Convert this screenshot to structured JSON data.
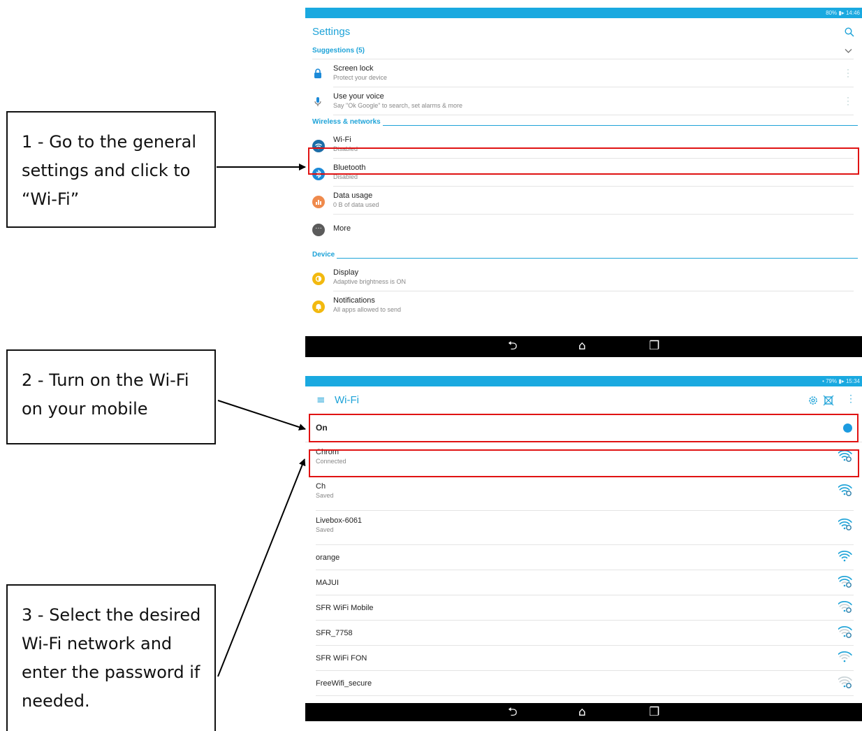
{
  "callouts": [
    {
      "text": "1 - Go to the general settings and click to “Wi-Fi”"
    },
    {
      "text": "2 - Turn on the Wi-Fi on your mobile"
    },
    {
      "text": "3 - Select the desired Wi-Fi network and enter the password if needed."
    }
  ],
  "settings_screen": {
    "status": "80% ▮▸ 14:46",
    "title": "Settings",
    "suggestions_label": "Suggestions (5)",
    "suggestions": [
      {
        "title": "Screen lock",
        "subtitle": "Protect your device",
        "icon": "lock-icon"
      },
      {
        "title": "Use your voice",
        "subtitle": "Say \"Ok Google\" to search, set alarms & more",
        "icon": "microphone-icon"
      }
    ],
    "wireless_label": "Wireless & networks",
    "wireless": [
      {
        "title": "Wi-Fi",
        "subtitle": "Disabled",
        "icon": "wifi-icon",
        "color": "#1c6ea8"
      },
      {
        "title": "Bluetooth",
        "subtitle": "Disabled",
        "icon": "bluetooth-icon",
        "color": "#1c8ad8"
      },
      {
        "title": "Data usage",
        "subtitle": "0 B of data used",
        "icon": "data-usage-icon",
        "color": "#ef8a4c"
      },
      {
        "title": "More",
        "subtitle": "",
        "icon": "more-icon",
        "color": "#5b5b5b"
      }
    ],
    "device_label": "Device",
    "device": [
      {
        "title": "Display",
        "subtitle": "Adaptive brightness is ON",
        "icon": "display-icon",
        "color": "#f2b90f"
      },
      {
        "title": "Notifications",
        "subtitle": "All apps allowed to send",
        "icon": "bell-icon",
        "color": "#f2b90f"
      }
    ]
  },
  "wifi_screen": {
    "status": "• 79% ▮▸ 15:34",
    "title": "Wi-Fi",
    "toggle_label": "On",
    "toggle_on": true,
    "networks": [
      {
        "name": "Chrom",
        "status": "Connected",
        "signal": 1.0,
        "locked": true
      },
      {
        "name": "Ch",
        "status": "Saved",
        "signal": 1.0,
        "locked": true
      },
      {
        "name": "Livebox-6061",
        "status": "Saved",
        "signal": 1.0,
        "locked": true
      },
      {
        "name": "orange",
        "status": "",
        "signal": 1.0,
        "locked": false
      },
      {
        "name": "MAJUI",
        "status": "",
        "signal": 0.75,
        "locked": true
      },
      {
        "name": "SFR WiFi Mobile",
        "status": "",
        "signal": 0.5,
        "locked": true
      },
      {
        "name": "SFR_7758",
        "status": "",
        "signal": 0.5,
        "locked": true
      },
      {
        "name": "SFR WiFi FON",
        "status": "",
        "signal": 0.5,
        "locked": false
      },
      {
        "name": "FreeWifi_secure",
        "status": "",
        "signal": 0.25,
        "locked": true
      }
    ]
  },
  "colors": {
    "accent": "#1ea3d8",
    "highlight": "#e01313",
    "statusbar": "#1aa9e0"
  }
}
